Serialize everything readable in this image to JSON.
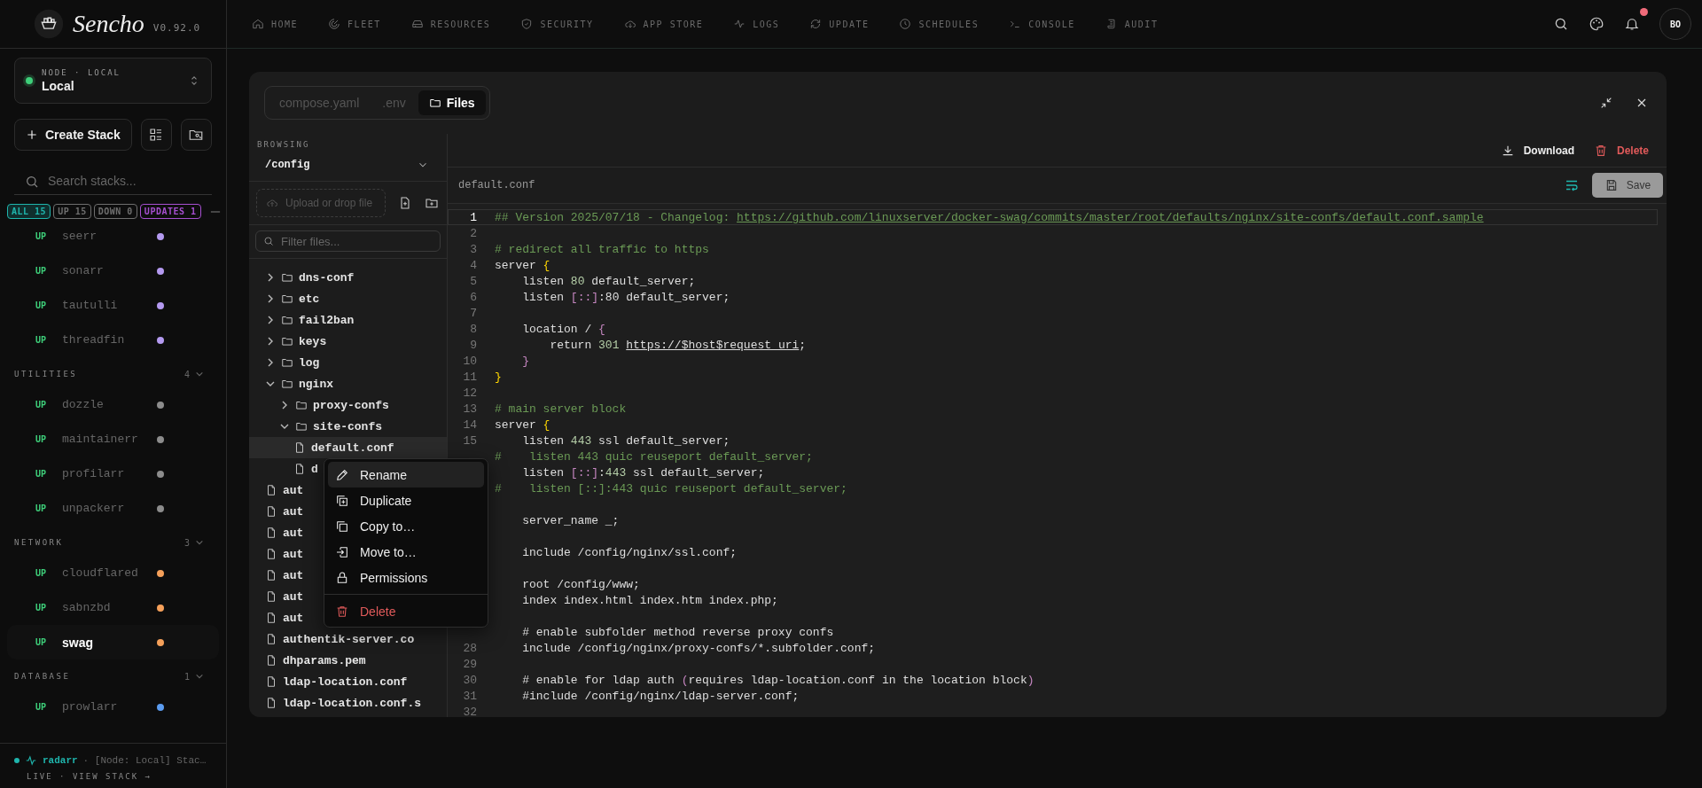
{
  "brand": {
    "name": "Sencho",
    "version": "V0.92.0"
  },
  "node": {
    "label": "NODE · LOCAL",
    "name": "Local",
    "online": true
  },
  "create_button": "Create Stack",
  "search": {
    "placeholder": "Search stacks..."
  },
  "filters": [
    {
      "label": "ALL 15",
      "selected": true,
      "color": "#1fb5ad"
    },
    {
      "label": "UP 15",
      "selected": false,
      "color": "#6e6e6e"
    },
    {
      "label": "DOWN 0",
      "selected": false,
      "color": "#6e6e6e"
    },
    {
      "label": "UPDATES 1",
      "selected": false,
      "color": "#a64fd0"
    }
  ],
  "groups": [
    {
      "items": [
        {
          "status": "UP",
          "name": "seerr",
          "color": "#b49af0",
          "selected": false
        },
        {
          "status": "UP",
          "name": "sonarr",
          "color": "#b49af0",
          "selected": false
        },
        {
          "status": "UP",
          "name": "tautulli",
          "color": "#b49af0",
          "selected": false
        },
        {
          "status": "UP",
          "name": "threadfin",
          "color": "#b49af0",
          "selected": false
        }
      ]
    },
    {
      "label": "UTILITIES",
      "count": "4",
      "items": [
        {
          "status": "UP",
          "name": "dozzle",
          "color": "#8c8c8c",
          "selected": false
        },
        {
          "status": "UP",
          "name": "maintainerr",
          "color": "#8c8c8c",
          "selected": false
        },
        {
          "status": "UP",
          "name": "profilarr",
          "color": "#8c8c8c",
          "selected": false
        },
        {
          "status": "UP",
          "name": "unpackerr",
          "color": "#8c8c8c",
          "selected": false
        }
      ]
    },
    {
      "label": "NETWORK",
      "count": "3",
      "items": [
        {
          "status": "UP",
          "name": "cloudflared",
          "color": "#f5a05a",
          "selected": false
        },
        {
          "status": "UP",
          "name": "sabnzbd",
          "color": "#f5a05a",
          "selected": false
        },
        {
          "status": "UP",
          "name": "swag",
          "color": "#f5a05a",
          "selected": true
        }
      ]
    },
    {
      "label": "DATABASE",
      "count": "1",
      "items": [
        {
          "status": "UP",
          "name": "prowlarr",
          "color": "#5b9cf0",
          "selected": false
        }
      ]
    }
  ],
  "activity": {
    "stack": "radarr",
    "message": "· [Node: Local] Stac…",
    "footer": "LIVE · VIEW STACK →"
  },
  "nav": [
    {
      "label": "HOME"
    },
    {
      "label": "FLEET"
    },
    {
      "label": "RESOURCES"
    },
    {
      "label": "SECURITY"
    },
    {
      "label": "APP STORE"
    },
    {
      "label": "LOGS"
    },
    {
      "label": "UPDATE"
    },
    {
      "label": "SCHEDULES"
    },
    {
      "label": "CONSOLE"
    },
    {
      "label": "AUDIT"
    }
  ],
  "notifications_unread": true,
  "avatar": "BO",
  "tabs": [
    {
      "label": "compose.yaml",
      "selected": false
    },
    {
      "label": ".env",
      "selected": false
    },
    {
      "label": "Files",
      "selected": true
    }
  ],
  "browser": {
    "heading": "BROWSING",
    "path": "/config",
    "upload": "Upload or drop file",
    "filter_placeholder": "Filter files...",
    "tree": [
      {
        "name": "dns-conf",
        "kind": "folder",
        "expanded": false
      },
      {
        "name": "etc",
        "kind": "folder",
        "expanded": false
      },
      {
        "name": "fail2ban",
        "kind": "folder",
        "expanded": false
      },
      {
        "name": "keys",
        "kind": "folder",
        "expanded": false
      },
      {
        "name": "log",
        "kind": "folder",
        "expanded": false
      },
      {
        "name": "nginx",
        "kind": "folder",
        "expanded": true,
        "children": [
          {
            "name": "proxy-confs",
            "kind": "folder",
            "expanded": false
          },
          {
            "name": "site-confs",
            "kind": "folder",
            "expanded": true,
            "children": [
              {
                "name": "default.conf",
                "kind": "file",
                "selected": true
              },
              {
                "name": "d",
                "kind": "file",
                "selected": false
              }
            ]
          }
        ]
      },
      {
        "name": "aut",
        "kind": "file",
        "selected": false
      },
      {
        "name": "aut",
        "kind": "file",
        "selected": false
      },
      {
        "name": "aut",
        "kind": "file",
        "selected": false
      },
      {
        "name": "aut",
        "kind": "file",
        "selected": false
      },
      {
        "name": "aut",
        "kind": "file",
        "selected": false
      },
      {
        "name": "aut",
        "kind": "file",
        "selected": false
      },
      {
        "name": "aut",
        "kind": "file",
        "selected": false
      },
      {
        "name": "authentik-server.co",
        "kind": "file",
        "selected": false
      },
      {
        "name": "dhparams.pem",
        "kind": "file",
        "selected": false
      },
      {
        "name": "ldap-location.conf",
        "kind": "file",
        "selected": false
      },
      {
        "name": "ldap-location.conf.s",
        "kind": "file",
        "selected": false
      }
    ]
  },
  "editor": {
    "download": "Download",
    "delete": "Delete",
    "filename": "default.conf",
    "save": "Save",
    "lines": [
      {
        "number": "1",
        "active": true,
        "segs": [
          {
            "kind": "comment",
            "text": "## Version 2025/07/18 - Changelog: "
          },
          {
            "kind": "comment-link",
            "text": "https://github.com/linuxserver/docker-swag/commits/master/root/defaults/nginx/site-confs/default.conf.sample"
          }
        ]
      },
      {
        "number": "2",
        "active": false
      },
      {
        "number": "3",
        "active": false,
        "segs": [
          {
            "kind": "comment",
            "text": "# redirect all traffic to https"
          }
        ]
      },
      {
        "number": "4",
        "active": false,
        "segs": [
          {
            "kind": "plain",
            "text": "server "
          },
          {
            "kind": "brace",
            "text": "{"
          }
        ]
      },
      {
        "number": "5",
        "active": false,
        "segs": [
          {
            "kind": "plain",
            "text": "    listen "
          },
          {
            "kind": "num",
            "text": "80"
          },
          {
            "kind": "plain",
            "text": " default_server;"
          }
        ]
      },
      {
        "number": "6",
        "active": false,
        "segs": [
          {
            "kind": "plain",
            "text": "    listen "
          },
          {
            "kind": "punct",
            "text": "[::]"
          },
          {
            "kind": "plain",
            "text": ":80 default_server;"
          }
        ]
      },
      {
        "number": "7",
        "active": false
      },
      {
        "number": "8",
        "active": false,
        "segs": [
          {
            "kind": "plain",
            "text": "    location / "
          },
          {
            "kind": "punct",
            "text": "{"
          }
        ]
      },
      {
        "number": "9",
        "active": false,
        "segs": [
          {
            "kind": "plain",
            "text": "        return "
          },
          {
            "kind": "num",
            "text": "301 "
          },
          {
            "kind": "link",
            "text": "https://$host$request_uri"
          },
          {
            "kind": "plain",
            "text": ";"
          }
        ]
      },
      {
        "number": "10",
        "active": false,
        "segs": [
          {
            "kind": "punct",
            "text": "    }"
          }
        ]
      },
      {
        "number": "11",
        "active": false,
        "segs": [
          {
            "kind": "brace",
            "text": "}"
          }
        ]
      },
      {
        "number": "12",
        "active": false
      },
      {
        "number": "13",
        "active": false,
        "segs": [
          {
            "kind": "comment",
            "text": "# main server block"
          }
        ]
      },
      {
        "number": "14",
        "active": false,
        "segs": [
          {
            "kind": "plain",
            "text": "server "
          },
          {
            "kind": "brace",
            "text": "{"
          }
        ]
      },
      {
        "number": "15",
        "active": false,
        "segs": [
          {
            "kind": "plain",
            "text": "    listen "
          },
          {
            "kind": "num",
            "text": "443"
          },
          {
            "kind": "plain",
            "text": " ssl default_server;"
          }
        ]
      },
      {
        "active": false,
        "segs": [
          {
            "kind": "comment",
            "text": "#    listen 443 quic reuseport default_server;"
          }
        ]
      },
      {
        "active": false,
        "segs": [
          {
            "kind": "plain",
            "text": "    listen "
          },
          {
            "kind": "punct",
            "text": "[::]"
          },
          {
            "kind": "plain",
            "text": ":"
          },
          {
            "kind": "num",
            "text": "443"
          },
          {
            "kind": "plain",
            "text": " ssl default_server;"
          }
        ]
      },
      {
        "active": false,
        "segs": [
          {
            "kind": "comment",
            "text": "#    listen [::]:443 quic reuseport default_server;"
          }
        ]
      },
      {
        "active": false
      },
      {
        "active": false,
        "segs": [
          {
            "kind": "plain",
            "text": "    server_name _;"
          }
        ]
      },
      {
        "active": false
      },
      {
        "active": false,
        "segs": [
          {
            "kind": "plain",
            "text": "    include /config/nginx/ssl.conf;"
          }
        ]
      },
      {
        "active": false
      },
      {
        "active": false,
        "segs": [
          {
            "kind": "plain",
            "text": "    root /config/www;"
          }
        ]
      },
      {
        "active": false,
        "segs": [
          {
            "kind": "plain",
            "text": "    index index.html index.htm index.php;"
          }
        ]
      },
      {
        "active": false
      },
      {
        "active": false,
        "segs": [
          {
            "kind": "plain",
            "text": "    # enable subfolder method reverse proxy confs"
          }
        ]
      },
      {
        "number": "28",
        "active": false,
        "segs": [
          {
            "kind": "plain",
            "text": "    include /config/nginx/proxy-confs/*.subfolder.conf;"
          }
        ]
      },
      {
        "number": "29",
        "active": false
      },
      {
        "number": "30",
        "active": false,
        "segs": [
          {
            "kind": "plain",
            "text": "    # enable for ldap auth "
          },
          {
            "kind": "punct",
            "text": "("
          },
          {
            "kind": "plain",
            "text": "requires ldap-location.conf in the location block"
          },
          {
            "kind": "punct",
            "text": ")"
          }
        ]
      },
      {
        "number": "31",
        "active": false,
        "segs": [
          {
            "kind": "plain",
            "text": "    #include /config/nginx/ldap-server.conf;"
          }
        ]
      },
      {
        "number": "32",
        "active": false
      }
    ]
  },
  "context_menu": [
    {
      "label": "Rename",
      "kind": "normal",
      "selected": true
    },
    {
      "label": "Duplicate",
      "kind": "normal",
      "selected": false
    },
    {
      "label": "Copy to…",
      "kind": "normal",
      "selected": false
    },
    {
      "label": "Move to…",
      "kind": "normal",
      "selected": false
    },
    {
      "label": "Permissions",
      "kind": "normal",
      "selected": false
    },
    {
      "label": "Delete",
      "kind": "danger",
      "selected": false
    }
  ]
}
